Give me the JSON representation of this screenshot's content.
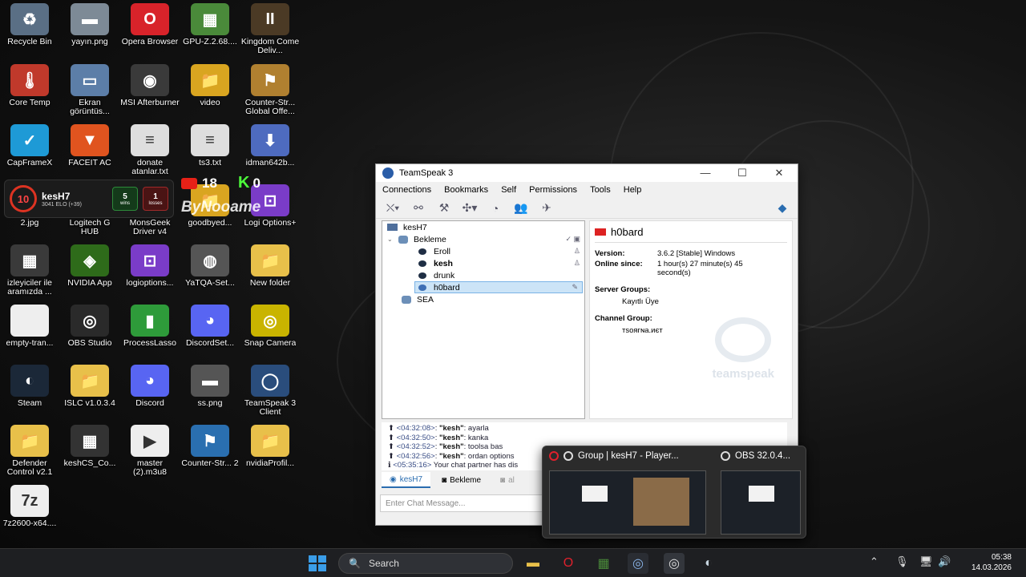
{
  "desktop": {
    "icons": [
      {
        "label": "Recycle Bin",
        "glyph": "♻",
        "color": "#5a6f85"
      },
      {
        "label": "yayın.png",
        "glyph": "▬",
        "color": "#7d8a96"
      },
      {
        "label": "Opera Browser",
        "glyph": "O",
        "color": "#d8232a"
      },
      {
        "label": "GPU-Z.2.68....",
        "glyph": "▦",
        "color": "#4a8a3a"
      },
      {
        "label": "Kingdom Come Deliv...",
        "glyph": "II",
        "color": "#4b3a25"
      },
      {
        "label": "Core Temp",
        "glyph": "🌡",
        "color": "#c0392b"
      },
      {
        "label": "Ekran görüntüs...",
        "glyph": "▭",
        "color": "#5c7ea8"
      },
      {
        "label": "MSI Afterburner",
        "glyph": "◉",
        "color": "#3a3a3a"
      },
      {
        "label": "video",
        "glyph": "📁",
        "color": "#d9a520"
      },
      {
        "label": "Counter-Str... Global Offe...",
        "glyph": "⚑",
        "color": "#b08030"
      },
      {
        "label": "CapFrameX",
        "glyph": "✓",
        "color": "#1e9ad6"
      },
      {
        "label": "FACEIT AC",
        "glyph": "▼",
        "color": "#e0541f"
      },
      {
        "label": "donate atanlar.txt",
        "glyph": "≡",
        "color": "#dedede"
      },
      {
        "label": "ts3.txt",
        "glyph": "≡",
        "color": "#dedede"
      },
      {
        "label": "idman642b...",
        "glyph": "⬇",
        "color": "#4e6bbf"
      },
      {
        "label": "2.jpg",
        "glyph": "▭",
        "color": "#444"
      },
      {
        "label": "Logitech G HUB",
        "glyph": "G",
        "color": "#333"
      },
      {
        "label": "MonsGeek Driver v4",
        "glyph": "M",
        "color": "#333"
      },
      {
        "label": "goodbyed...",
        "glyph": "📁",
        "color": "#d9a520"
      },
      {
        "label": "Logi Options+",
        "glyph": "⊡",
        "color": "#7a3cc8"
      },
      {
        "label": "izleyiciler ile aramızda ...",
        "glyph": "▦",
        "color": "#3a3a3a"
      },
      {
        "label": "NVIDIA App",
        "glyph": "◈",
        "color": "#2e6b1a"
      },
      {
        "label": "logioptions...",
        "glyph": "⊡",
        "color": "#7a3cc8"
      },
      {
        "label": "YaTQA-Set...",
        "glyph": "◍",
        "color": "#555"
      },
      {
        "label": "New folder",
        "glyph": "📁",
        "color": "#e8c04a"
      },
      {
        "label": "empty-tran...",
        "glyph": "",
        "color": "#eeeeee"
      },
      {
        "label": "OBS Studio",
        "glyph": "◎",
        "color": "#2a2a2a"
      },
      {
        "label": "ProcessLasso",
        "glyph": "▮",
        "color": "#2e9b3a"
      },
      {
        "label": "DiscordSet...",
        "glyph": "◕",
        "color": "#5865f2"
      },
      {
        "label": "Snap Camera",
        "glyph": "◎",
        "color": "#c9b400"
      },
      {
        "label": "Steam",
        "glyph": "◐",
        "color": "#1b2838"
      },
      {
        "label": "ISLC v1.0.3.4",
        "glyph": "📁",
        "color": "#e8c04a"
      },
      {
        "label": "Discord",
        "glyph": "◕",
        "color": "#5865f2"
      },
      {
        "label": "ss.png",
        "glyph": "▬",
        "color": "#555"
      },
      {
        "label": "TeamSpeak 3 Client",
        "glyph": "◯",
        "color": "#2a4d7c"
      },
      {
        "label": "Defender Control v2.1",
        "glyph": "📁",
        "color": "#e8c04a"
      },
      {
        "label": "keshCS_Co...",
        "glyph": "▦",
        "color": "#333"
      },
      {
        "label": "master (2).m3u8",
        "glyph": "▶",
        "color": "#eeeeee"
      },
      {
        "label": "Counter-Str... 2",
        "glyph": "⚑",
        "color": "#2a6fb0"
      },
      {
        "label": "nvidiaProfil...",
        "glyph": "📁",
        "color": "#e8c04a"
      },
      {
        "label": "7z2600-x64....",
        "glyph": "7z",
        "color": "#eeeeee"
      }
    ],
    "overlay_texts": {
      "yt_count": "18",
      "k_count": "0",
      "watermark": "ByNooame"
    }
  },
  "faceit_widget": {
    "level": "10",
    "name": "kesH7",
    "elo": "3041 ELO (+39)",
    "wins": "5",
    "wins_label": "wins",
    "losses": "1",
    "losses_label": "losses"
  },
  "teamspeak": {
    "title": "TeamSpeak 3",
    "menu": [
      "Connections",
      "Bookmarks",
      "Self",
      "Permissions",
      "Tools",
      "Help"
    ],
    "tree": {
      "server": "kesH7",
      "channels": [
        {
          "name": "Bekleme",
          "clients": [
            "Eroll",
            "kesh",
            "drunk",
            "h0bard"
          ]
        },
        {
          "name": "SEA",
          "clients": []
        }
      ],
      "selected": "h0bard"
    },
    "info": {
      "name": "h0bard",
      "version_label": "Version:",
      "version": "3.6.2 [Stable] Windows",
      "online_label": "Online since:",
      "online": "1 hour(s) 27 minute(s) 45 second(s)",
      "server_groups_label": "Server Groups:",
      "server_groups": "Kayıtlı Üye",
      "channel_group_label": "Channel Group:",
      "channel_group": "тsоягɴа.иєт",
      "watermark": "teamspeak"
    },
    "chat": [
      {
        "time": "<04:32:08>",
        "who": "\"kesh\"",
        "msg": ": ayarla"
      },
      {
        "time": "<04:32:50>",
        "who": "\"kesh\"",
        "msg": ": kanka"
      },
      {
        "time": "<04:32:52>",
        "who": "\"kesh\"",
        "msg": ": toolsa bas"
      },
      {
        "time": "<04:32:56>",
        "who": "\"kesh\"",
        "msg": ": ordan options"
      },
      {
        "time": "<05:35:16>",
        "who": "",
        "msg": " Your chat partner has dis"
      }
    ],
    "tabs": [
      "kesH7",
      "Bekleme",
      "al"
    ],
    "chat_placeholder": "Enter Chat Message..."
  },
  "taskbar_preview": {
    "items": [
      {
        "title": "Group | kesH7 - Player..."
      },
      {
        "title": "OBS 32.0.4..."
      }
    ]
  },
  "taskbar": {
    "search_label": "Search",
    "time": "05:38",
    "date": "14.03.2026"
  }
}
